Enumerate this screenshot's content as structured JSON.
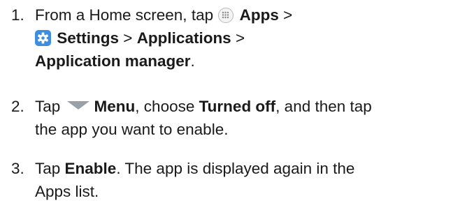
{
  "steps": [
    {
      "number": "1.",
      "lines": {
        "l1_pre": "From a Home screen, tap",
        "l1_apps": "Apps",
        "l1_sep": " >",
        "l2_settings": "Settings",
        "l2_sep": " > ",
        "l2_applications": "Applications",
        "l2_sep2": " >",
        "l3_appmanager": "Application manager",
        "l3_end": "."
      }
    },
    {
      "number": "2.",
      "lines": {
        "l1_pre": "Tap",
        "l1_menu": "Menu",
        "l1_mid": ", choose ",
        "l1_turnedoff": "Turned off",
        "l1_end": ", and then tap",
        "l2": "the app you want to enable."
      }
    },
    {
      "number": "3.",
      "lines": {
        "l1_pre": "Tap ",
        "l1_enable": "Enable",
        "l1_end": ". The app is displayed again in the",
        "l2": "Apps list."
      }
    }
  ],
  "icons": {
    "apps": "apps-grid-icon",
    "settings": "settings-gear-icon",
    "menu": "menu-dropdown-icon"
  },
  "colors": {
    "text": "#1a1a1a",
    "settings_icon_bg": "#3d8ee0",
    "menu_triangle": "#9aa0a8"
  }
}
